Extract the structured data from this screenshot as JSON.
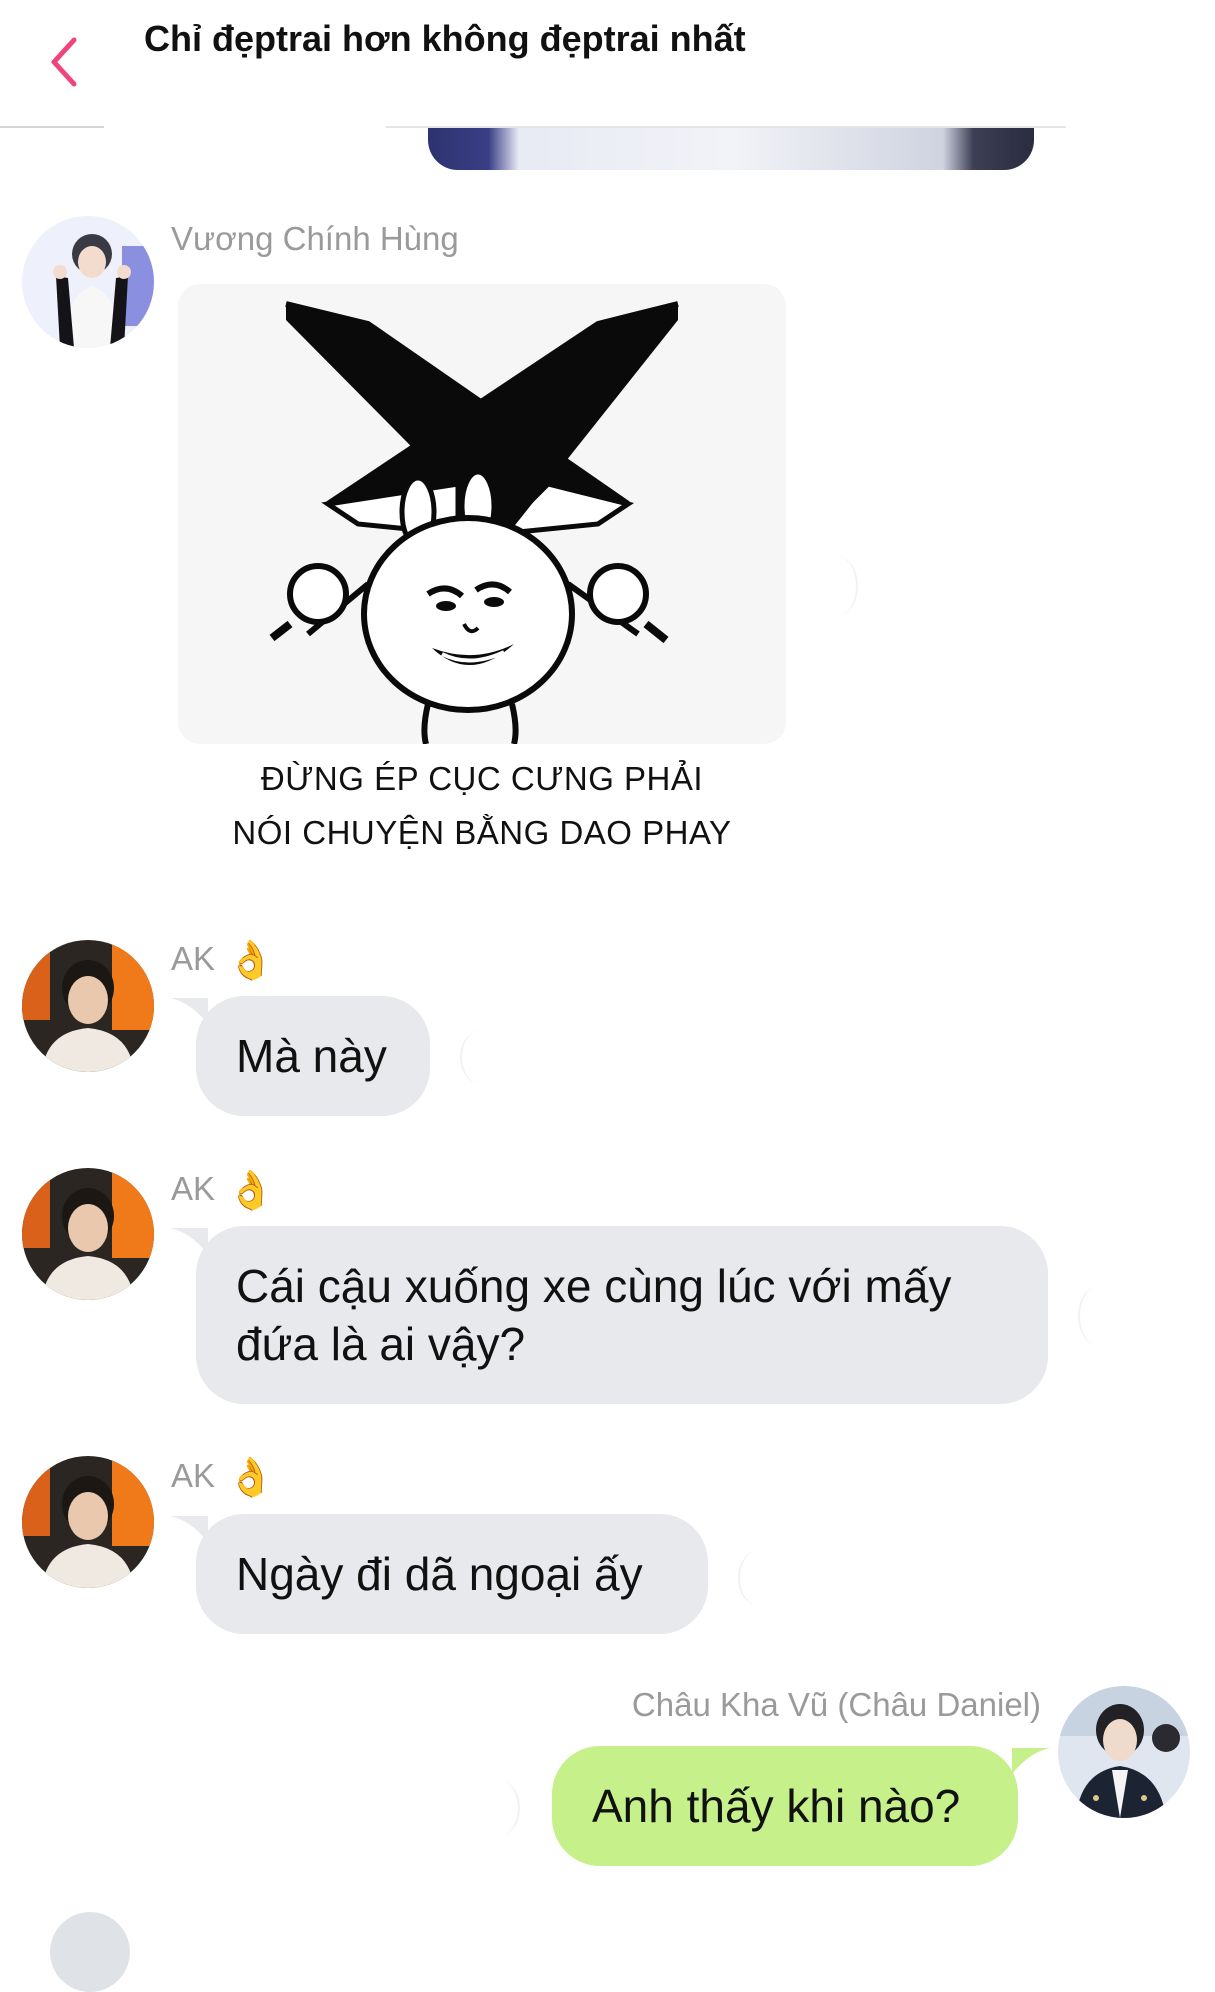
{
  "header": {
    "title": "Chỉ đẹptrai hơn không đẹptrai nhất"
  },
  "messages": [
    {
      "sender": "Vương Chính Hùng",
      "type": "sticker",
      "caption_line1": "ĐỪNG ÉP CỤC CƯNG PHẢI",
      "caption_line2": "NÓI CHUYỆN BẰNG DAO PHAY"
    },
    {
      "sender": "AK",
      "badge": "👌",
      "text": "Mà này"
    },
    {
      "sender": "AK",
      "badge": "👌",
      "text_line1": "Cái cậu xuống xe cùng lúc với mấy",
      "text_line2": "đứa là ai vậy?"
    },
    {
      "sender": "AK",
      "badge": "👌",
      "text": "Ngày đi dã ngoại ấy"
    },
    {
      "sender": "Châu Kha Vũ (Châu Daniel)",
      "text": "Anh thấy khi nào?"
    }
  ],
  "colors": {
    "accent": "#f0457a",
    "incoming_bubble": "#e8e9ec",
    "outgoing_bubble": "#c5f08a",
    "name_text": "#9a9a9a"
  }
}
